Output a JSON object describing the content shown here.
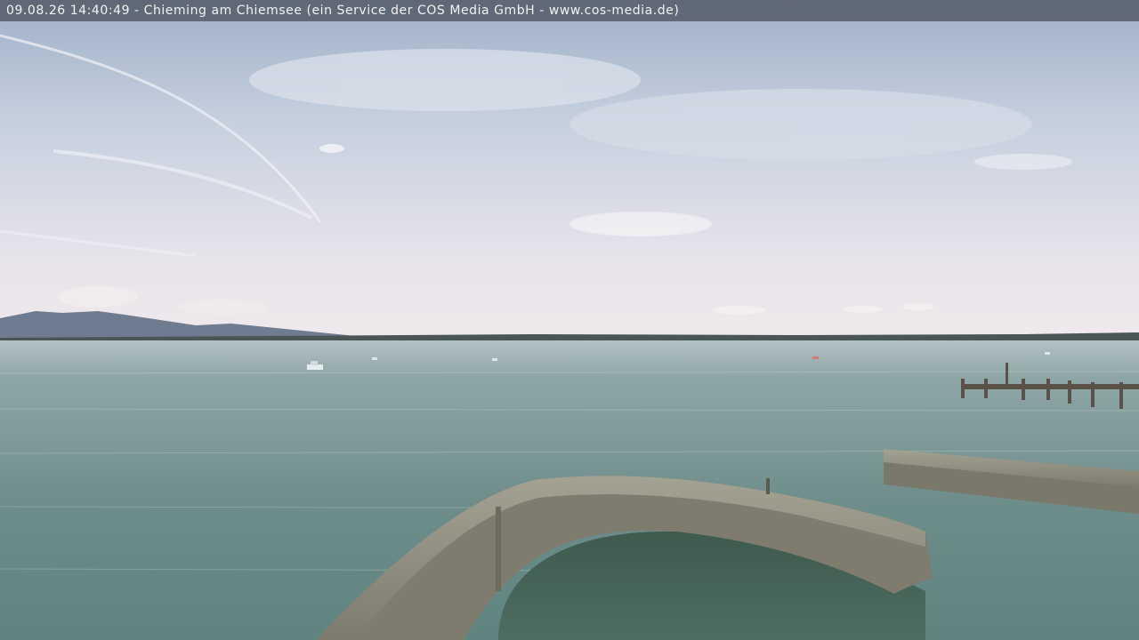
{
  "overlay": {
    "caption": "09.08.26 14:40:49 - Chieming am Chiemsee (ein Service der COS Media GmbH - www.cos-media.de)"
  },
  "scene": {
    "sky_color": "#c9d3e2",
    "horizon_color": "#ece7ec",
    "water_color": "#6f8f8c",
    "wall_color": "#8c8a7c"
  }
}
